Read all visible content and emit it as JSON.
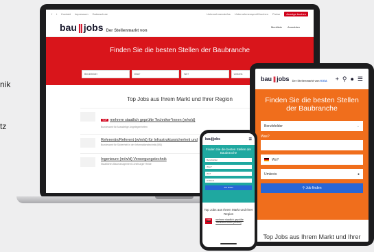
{
  "left_text": [
    "nik",
    "tz"
  ],
  "laptop": {
    "topbar": [
      "Kontakt",
      "Impressum",
      "Datenschutz"
    ],
    "topbar_right": [
      "Unternehmensinfos",
      "Unternehmensprofil buchen",
      "Preise"
    ],
    "topbar_cta": "Anzeige buchen",
    "logo_main": "bau",
    "logo_bars": "||",
    "logo_end": "jobs",
    "logo_sub": "Der Stellenmarkt von",
    "account": [
      "Merkliste",
      "Anmelden"
    ],
    "hero_title": "Finden Sie die besten Stellen der Baubranche",
    "search": {
      "field1": "Berufsfelder",
      "field2": "Was?",
      "field3": "Wo?",
      "field4": "Umkreis",
      "button": "Job finden"
    },
    "section_title": "Top Jobs aus Ihrem Markt und Ihrer Region",
    "jobs": [
      {
        "badge": "TOP",
        "title": "mehrere staatlich geprüfte Techniker*innen (m/w/d)",
        "meta": "Bundesamt für Auswärtige Angelegenheiten"
      },
      {
        "badge": "",
        "title": "Referentin/Referent (w/m/d) für Infrastruktursicherheit und",
        "meta": "Bundesamt für Sicherheit in der Informationstechnik (BSI)"
      },
      {
        "badge": "",
        "title": "Ingenieure (m/w/d) Versorgungstechnik",
        "meta": "Staatliches Baumanagement Lüneburger Heide"
      }
    ]
  },
  "tablet": {
    "logo_main": "bau",
    "logo_bars": "||",
    "logo_end": "jobs",
    "logo_sub": "Der Stellenmarkt von",
    "logo_brand": "KIGA",
    "hero_title": "Finden Sie die besten Stellen der Baubranche",
    "field_berufsfelder": "Berufsfelder",
    "label_was": "Was?",
    "field_wo": "Wo?",
    "field_umkreis": "Umkreis",
    "button": "Job finden",
    "section_title": "Top Jobs aus Ihrem Markt und Ihrer Region"
  },
  "phone": {
    "logo": "bau||jobs",
    "hero_title": "Finden Sie die besten Stellen der Baubranche",
    "fields": [
      "Berufsfelder",
      "Was?",
      "Wo?",
      "Umkreis"
    ],
    "button": "Job finden",
    "section_title": "Top Jobs aus Ihrem Markt und Ihrer Region",
    "job_badge": "TOP",
    "job_title": "mehrere staatlich geprüfte Techniker*innen (m/w/d)"
  },
  "colors": {
    "laptop_hero": "#d9151b",
    "tablet_hero": "#f06e1c",
    "phone_hero": "#1fa8a0",
    "button": "#2866d6"
  }
}
